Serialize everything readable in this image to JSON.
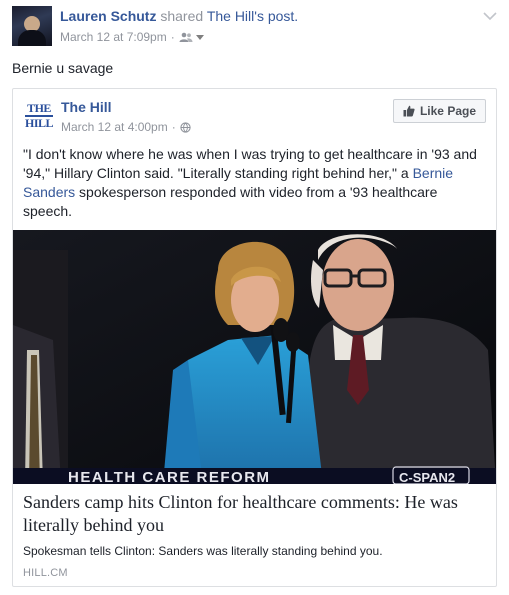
{
  "post": {
    "author": "Lauren Schutz",
    "shared_verb": "shared",
    "shared_source": "The Hill's post.",
    "timestamp": "March 12 at 7:09pm",
    "audience_icon": "friends-icon",
    "message": "Bernie u savage"
  },
  "shared_post": {
    "page_name": "The Hill",
    "logo_line1": "THE",
    "logo_line2": "HILL",
    "timestamp": "March 12 at 4:00pm",
    "audience_icon": "globe-icon",
    "like_button_label": "Like Page",
    "text_part1": "\"I don't know where he was when I was trying to get healthcare in '93 and '94,\" Hillary Clinton said. \"Literally standing right behind her,\" a ",
    "text_link": "Bernie Sanders",
    "text_part2": " spokesperson responded with video from a '93 healthcare speech.",
    "photo_caption_banner": "HEALTH CARE REFORM",
    "photo_channel_bug": "C-SPAN2",
    "link_title": "Sanders camp hits Clinton for healthcare comments: He was literally behind you",
    "link_description": "Spokesman tells Clinton: Sanders was literally standing behind you.",
    "link_domain": "HILL.CM"
  },
  "colors": {
    "link_blue": "#365899",
    "muted_gray": "#90949c",
    "border": "#dddfe2",
    "text": "#1d2129"
  }
}
